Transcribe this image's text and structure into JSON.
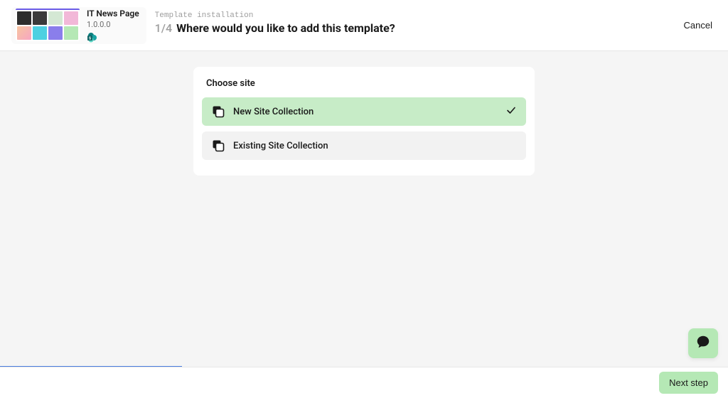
{
  "header": {
    "template_name": "IT News Page",
    "template_version": "1.0.0.0",
    "wizard_sub": "Template installation",
    "step_count": "1/4",
    "wizard_title": "Where would you like to add this template?",
    "cancel_label": "Cancel"
  },
  "panel": {
    "title": "Choose site",
    "options": [
      {
        "label": "New Site Collection",
        "selected": true
      },
      {
        "label": "Existing Site Collection",
        "selected": false
      }
    ]
  },
  "footer": {
    "next_label": "Next step"
  },
  "icons": {
    "chat": "chat-icon",
    "collection": "collection-icon",
    "check": "check-icon",
    "sharepoint": "sharepoint-icon"
  }
}
